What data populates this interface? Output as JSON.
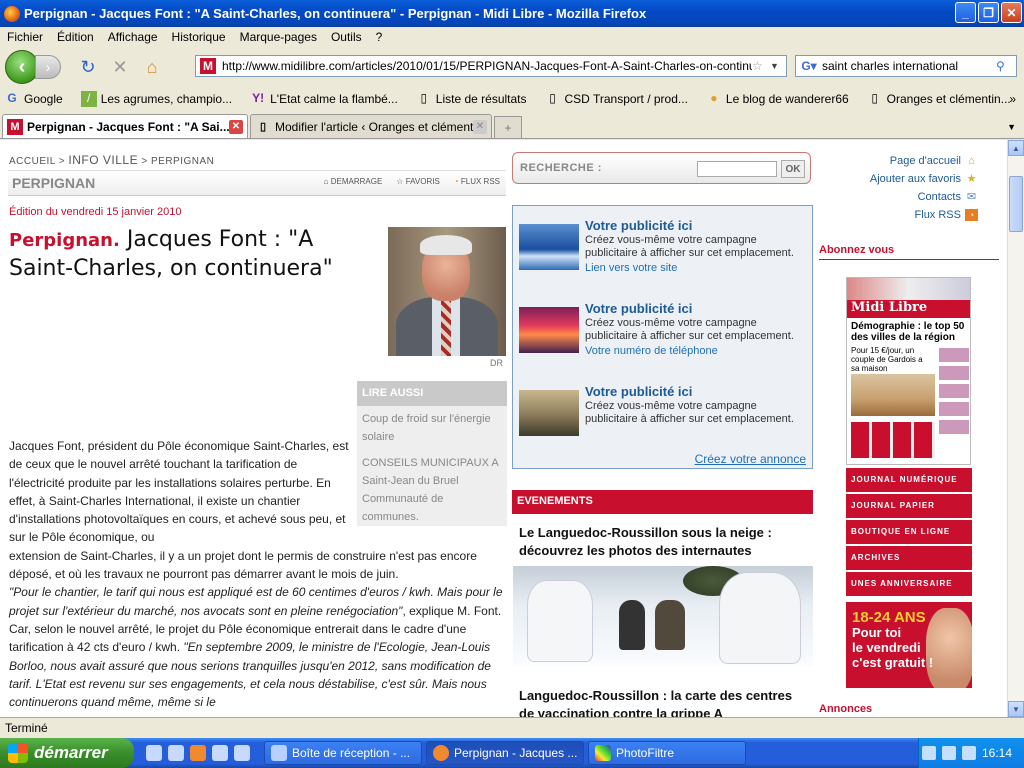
{
  "window": {
    "title": "Perpignan - Jacques Font : \"A Saint-Charles, on continuera\" - Perpignan - Midi Libre - Mozilla Firefox"
  },
  "menu": [
    "Fichier",
    "Édition",
    "Affichage",
    "Historique",
    "Marque-pages",
    "Outils",
    "?"
  ],
  "nav": {
    "url": "http://www.midilibre.com/articles/2010/01/15/PERPIGNAN-Jacques-Font-A-Saint-Charles-on-continuera-107",
    "search_value": "saint charles international"
  },
  "bookmarks": [
    "Google",
    "Les agrumes, champio...",
    "L'Etat calme la flambé...",
    "Liste de résultats",
    "CSD Transport / prod...",
    "Le blog de wanderer66",
    "Oranges et clémentin..."
  ],
  "tabs": [
    {
      "label": "Perpignan - Jacques Font : \"A Sai..."
    },
    {
      "label": "Modifier l'article ‹ Oranges et clémentin..."
    }
  ],
  "page": {
    "breadcrumb": {
      "a": "ACCUEIL",
      "b": "INFO VILLE",
      "c": "PERPIGNAN"
    },
    "section": "PERPIGNAN",
    "actions": [
      "DEMARRAGE",
      "FAVORIS",
      "FLUX RSS"
    ],
    "edition": "Édition du vendredi 15 janvier 2010",
    "city": "Perpignan.",
    "headline": "Jacques Font : \"A Saint-Charles, on continuera\"",
    "photo_credit": "DR",
    "lire_aussi": {
      "title": "LIRE AUSSI",
      "links": [
        "Coup de froid sur l'énergie solaire",
        "CONSEILS MUNICIPAUX A Saint-Jean du Bruel Communauté de communes."
      ]
    },
    "body": {
      "p1": "Jacques Font, président du Pôle économique Saint-Charles, est de ceux que le nouvel arrêté touchant la tarification de l'électricité produite par les installations solaires perturbe. En effet, à Saint-Charles International, il existe un chantier d'installations photovoltaïques en cours, et achevé sous peu, et sur le Pôle économique, ou",
      "p2": "extension de Saint-Charles, il y a un projet dont le permis de construire n'est pas encore déposé, et où les travaux ne pourront pas démarrer avant le mois de juin.",
      "q1": "\"Pour le chantier, le tarif qui nous est appliqué est de 60 centimes d'euros / kwh. Mais pour le projet sur l'extérieur du marché, nos avocats sont en pleine renégociation\"",
      "t1": ", explique M. Font. Car, selon le nouvel arrêté, le projet du Pôle économique entrerait dans le cadre d'une tarification à 42 cts d'euro / kwh.",
      "q2": "\"En septembre 2009, le ministre de l'Ecologie, Jean-Louis Borloo, nous avait assuré que nous serions tranquilles jusqu'en 2012, sans modification de tarif. L'Etat est revenu sur ses engagements, et cela nous déstabilise, c'est sûr. Mais nous continuerons quand même, même si le"
    },
    "recherche": {
      "label": "RECHERCHE :",
      "ok": "OK"
    },
    "ads": [
      {
        "title": "Votre publicité ici",
        "desc": "Créez vous-même votre campagne publicitaire à afficher sur cet emplacement.",
        "link": "Lien vers votre site"
      },
      {
        "title": "Votre publicité ici",
        "desc": "Créez vous-même votre campagne publicitaire à afficher sur cet emplacement.",
        "link": "Votre numéro de téléphone"
      },
      {
        "title": "Votre publicité ici",
        "desc": "Créez vous-même votre campagne publicitaire à afficher sur cet emplacement.",
        "link": ""
      }
    ],
    "ads_cta": "Créez votre annonce",
    "events": {
      "title": "EVENEMENTS",
      "item1": "Le Languedoc-Roussillon sous la neige : découvrez les photos des internautes",
      "item2": "Languedoc-Roussillon : la carte des centres de vaccination contre la grippe A"
    },
    "right_links": [
      "Page d'accueil",
      "Ajouter aux favoris",
      "Contacts",
      "Flux RSS"
    ],
    "abonnez": "Abonnez vous",
    "paper": {
      "mast": "Midi Libre",
      "headline": "Démographie : le top 50 des villes de la région",
      "sub": "Pour 15 €/jour, un couple de Gardois a sa maison"
    },
    "red_buttons": [
      "JOURNAL NUMÉRIQUE",
      "JOURNAL PAPIER",
      "BOUTIQUE EN LIGNE",
      "ARCHIVES",
      "UNES ANNIVERSAIRE"
    ],
    "promo": {
      "l1": "18-24 ANS",
      "l2": "Pour toi",
      "l3": "le vendredi",
      "l4": "c'est gratuit !"
    },
    "annonces": "Annonces"
  },
  "status": "Terminé",
  "taskbar": {
    "start": "démarrer",
    "tasks": [
      "Boîte de réception - ...",
      "Perpignan - Jacques ...",
      "PhotoFiltre"
    ],
    "clock": "16:14"
  }
}
